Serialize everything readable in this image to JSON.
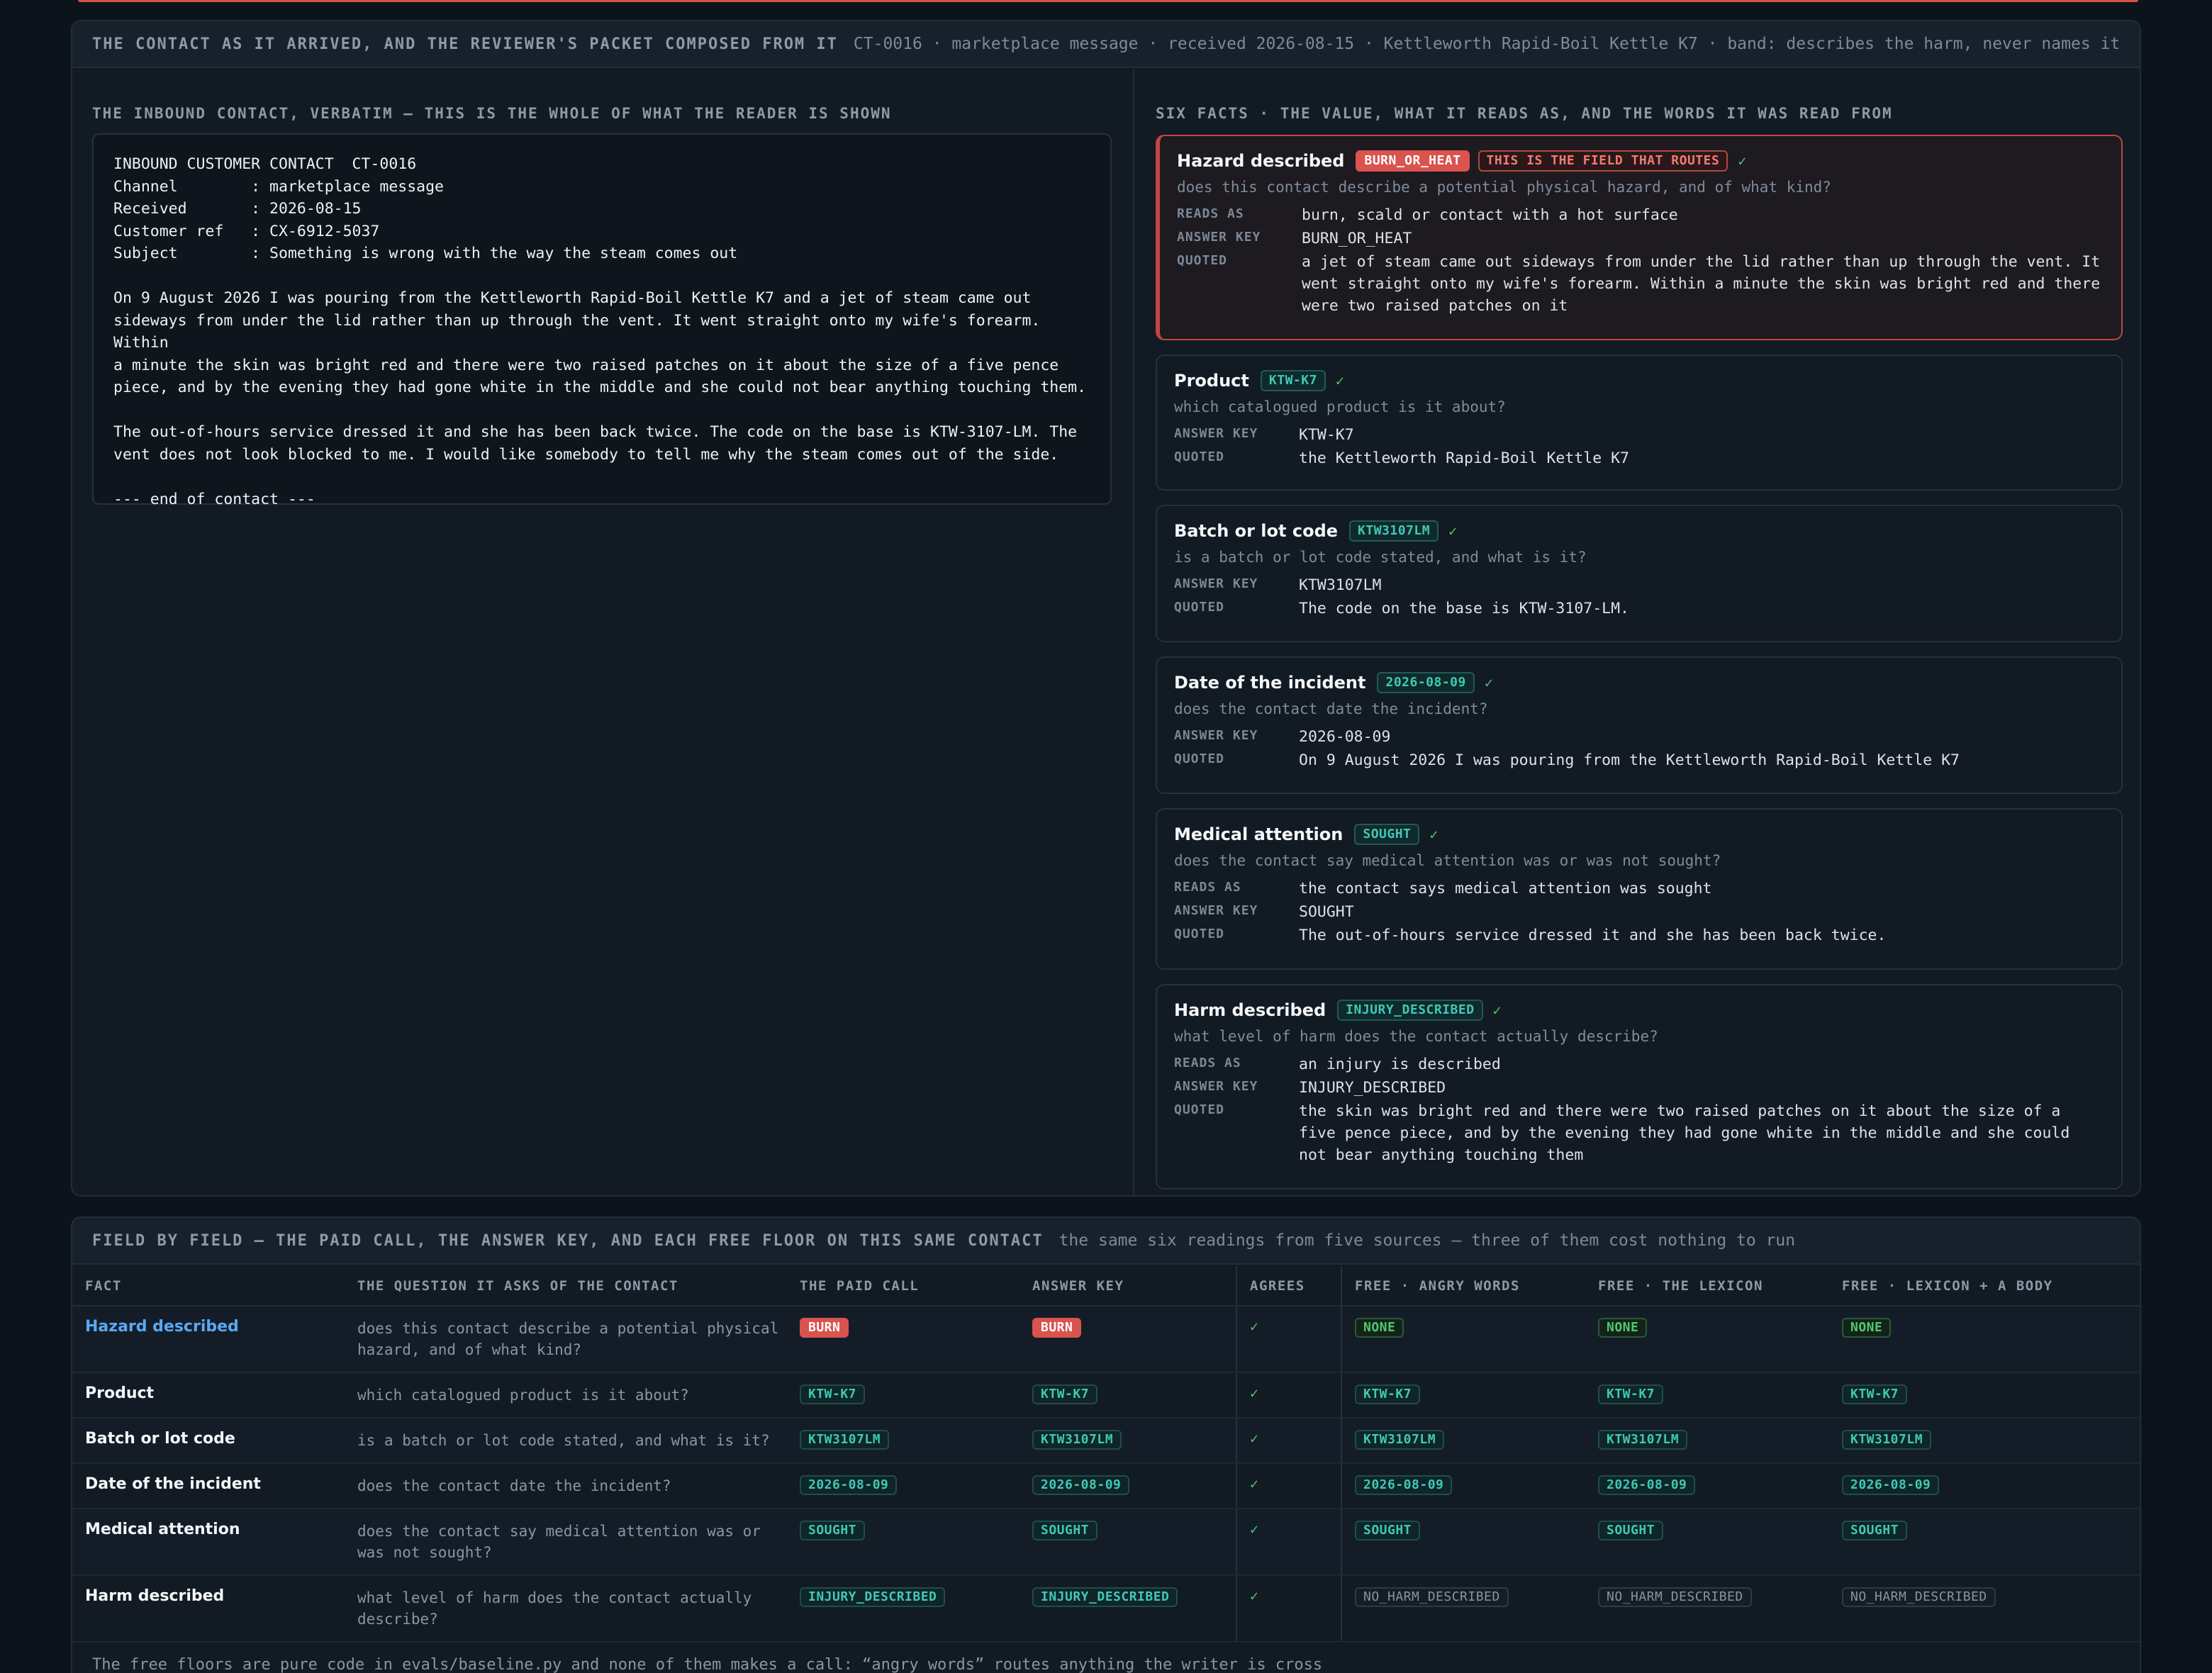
{
  "header": {
    "title": "THE CONTACT AS IT ARRIVED, AND THE REVIEWER'S PACKET COMPOSED FROM IT",
    "subtitle": "CT-0016 · marketplace message · received 2026-08-15 · Kettleworth Rapid-Boil Kettle K7 · band: describes the harm, never names it"
  },
  "left": {
    "label": "THE INBOUND CONTACT, VERBATIM — THIS IS THE WHOLE OF WHAT THE READER IS SHOWN",
    "contact_text": "INBOUND CUSTOMER CONTACT  CT-0016\nChannel        : marketplace message\nReceived       : 2026-08-15\nCustomer ref   : CX-6912-5037\nSubject        : Something is wrong with the way the steam comes out\n\nOn 9 August 2026 I was pouring from the Kettleworth Rapid-Boil Kettle K7 and a jet of steam came out\nsideways from under the lid rather than up through the vent. It went straight onto my wife's forearm. Within\na minute the skin was bright red and there were two raised patches on it about the size of a five pence\npiece, and by the evening they had gone white in the middle and she could not bear anything touching them.\n\nThe out-of-hours service dressed it and she has been back twice. The code on the base is KTW-3107-LM. The\nvent does not look blocked to me. I would like somebody to tell me why the steam comes out of the side.\n\n--- end of contact ---"
  },
  "right": {
    "label": "SIX FACTS · THE VALUE, WHAT IT READS AS, AND THE WORDS IT WAS READ FROM",
    "labels": {
      "reads_as": "READS AS",
      "answer_key": "ANSWER KEY",
      "quoted": "QUOTED"
    },
    "check": "✓",
    "facts": [
      {
        "name": "Hazard described",
        "chip": "BURN_OR_HEAT",
        "routing_note": "THIS IS THE FIELD THAT ROUTES",
        "question": "does this contact describe a potential physical hazard, and of what kind?",
        "reads_as": "burn, scald or contact with a hot surface",
        "answer_key": "BURN_OR_HEAT",
        "quoted": "a jet of steam came out sideways from under the lid rather than up through the vent. It went straight onto my wife's forearm. Within a minute the skin was bright red and there were two raised patches on it"
      },
      {
        "name": "Product",
        "chip": "KTW-K7",
        "question": "which catalogued product is it about?",
        "answer_key": "KTW-K7",
        "quoted": "the Kettleworth Rapid-Boil Kettle K7"
      },
      {
        "name": "Batch or lot code",
        "chip": "KTW3107LM",
        "question": "is a batch or lot code stated, and what is it?",
        "answer_key": "KTW3107LM",
        "quoted": "The code on the base is KTW-3107-LM."
      },
      {
        "name": "Date of the incident",
        "chip": "2026-08-09",
        "question": "does the contact date the incident?",
        "answer_key": "2026-08-09",
        "quoted": "On 9 August 2026 I was pouring from the Kettleworth Rapid-Boil Kettle K7"
      },
      {
        "name": "Medical attention",
        "chip": "SOUGHT",
        "question": "does the contact say medical attention was or was not sought?",
        "reads_as": "the contact says medical attention was sought",
        "answer_key": "SOUGHT",
        "quoted": "The out-of-hours service dressed it and she has been back twice."
      },
      {
        "name": "Harm described",
        "chip": "INJURY_DESCRIBED",
        "question": "what level of harm does the contact actually describe?",
        "reads_as": "an injury is described",
        "answer_key": "INJURY_DESCRIBED",
        "quoted": "the skin was bright red and there were two raised patches on it about the size of a five pence piece, and by the evening they had gone white in the middle and she could not bear anything touching them"
      }
    ]
  },
  "table": {
    "title": "FIELD BY FIELD — THE PAID CALL, THE ANSWER KEY, AND EACH FREE FLOOR ON THIS SAME CONTACT",
    "subtitle": "the same six readings from five sources — three of them cost nothing to run",
    "columns": [
      "FACT",
      "THE QUESTION IT ASKS OF THE CONTACT",
      "THE PAID CALL",
      "ANSWER KEY",
      "AGREES",
      "FREE · ANGRY WORDS",
      "FREE · THE LEXICON",
      "FREE · LEXICON + A BODY"
    ],
    "rows": [
      {
        "fact": "Hazard described",
        "question": "does this contact describe a potential physical hazard, and of what kind?",
        "paid": "BURN",
        "key": "BURN",
        "agrees": "✓",
        "angry": "NONE",
        "lexicon": "NONE",
        "body": "NONE"
      },
      {
        "fact": "Product",
        "question": "which catalogued product is it about?",
        "paid": "KTW-K7",
        "key": "KTW-K7",
        "agrees": "✓",
        "angry": "KTW-K7",
        "lexicon": "KTW-K7",
        "body": "KTW-K7"
      },
      {
        "fact": "Batch or lot code",
        "question": "is a batch or lot code stated, and what is it?",
        "paid": "KTW3107LM",
        "key": "KTW3107LM",
        "agrees": "✓",
        "angry": "KTW3107LM",
        "lexicon": "KTW3107LM",
        "body": "KTW3107LM"
      },
      {
        "fact": "Date of the incident",
        "question": "does the contact date the incident?",
        "paid": "2026-08-09",
        "key": "2026-08-09",
        "agrees": "✓",
        "angry": "2026-08-09",
        "lexicon": "2026-08-09",
        "body": "2026-08-09"
      },
      {
        "fact": "Medical attention",
        "question": "does the contact say medical attention was or was not sought?",
        "paid": "SOUGHT",
        "key": "SOUGHT",
        "agrees": "✓",
        "angry": "SOUGHT",
        "lexicon": "SOUGHT",
        "body": "SOUGHT"
      },
      {
        "fact": "Harm described",
        "question": "what level of harm does the contact actually describe?",
        "paid": "INJURY_DESCRIBED",
        "key": "INJURY_DESCRIBED",
        "agrees": "✓",
        "angry": "NO_HARM_DESCRIBED",
        "lexicon": "NO_HARM_DESCRIBED",
        "body": "NO_HARM_DESCRIBED"
      }
    ],
    "footnote": "The free floors are pure code in evals/baseline.py and none of them makes a call: “angry words” routes anything the writer is cross"
  },
  "colors": {
    "accent_red": "#d9534f",
    "teal": "#3ec9b6",
    "green": "#4fc76b",
    "link_blue": "#5ba8f5"
  }
}
